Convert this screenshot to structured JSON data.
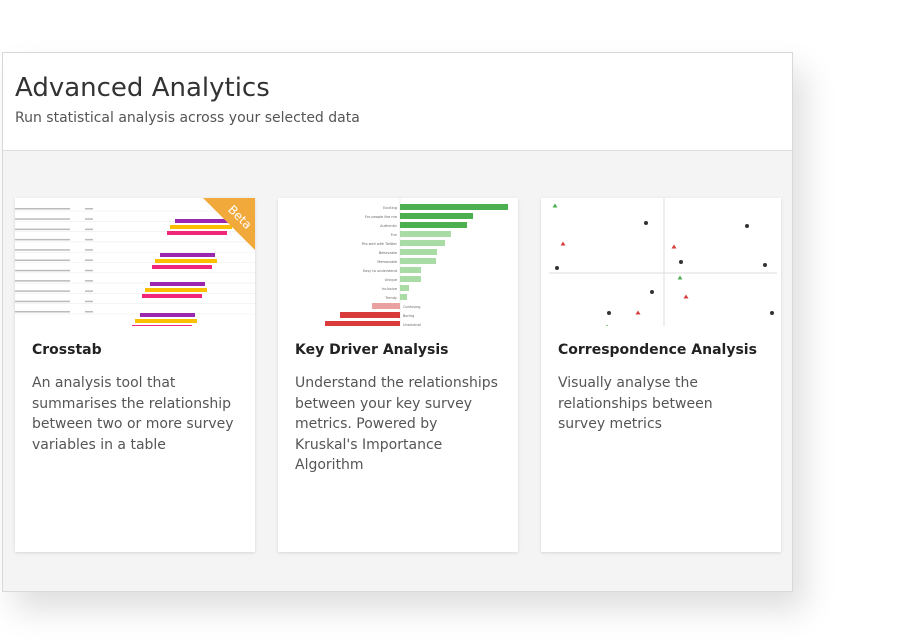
{
  "header": {
    "title": "Advanced Analytics",
    "subtitle": "Run statistical analysis across your selected data"
  },
  "cards": [
    {
      "title": "Crosstab",
      "description": "An analysis tool that summarises the relationship between two or more survey variables in a table",
      "badge": "Beta",
      "thumbnail": "crosstab-preview"
    },
    {
      "title": "Key Driver Analysis",
      "description": "Understand the relationships between your key survey metrics. Powered by Kruskal's Importance Algorithm",
      "thumbnail": "key-driver-preview"
    },
    {
      "title": "Correspondence Analysis",
      "description": "Visually analyse the relationships between survey metrics",
      "thumbnail": "correspondence-preview"
    }
  ],
  "key_driver_preview": {
    "labels": [
      "Exciting",
      "For people like me",
      "Authentic",
      "Fun",
      "Fits well with Twitter",
      "Believable",
      "Memorable",
      "Easy to understand",
      "Unique",
      "Inclusive",
      "Trendy",
      "Confusing",
      "Boring",
      "Unoriginal"
    ]
  },
  "colors": {
    "beta_badge": "#f2a93b",
    "purple_bar": "#9b27b0",
    "yellow_bar": "#fbbf00",
    "pink_bar": "#f0267a",
    "positive_strong": "#4cb050",
    "positive_light": "#a9dca5",
    "negative_light": "#eba0a0",
    "negative_strong": "#d93b3b"
  }
}
